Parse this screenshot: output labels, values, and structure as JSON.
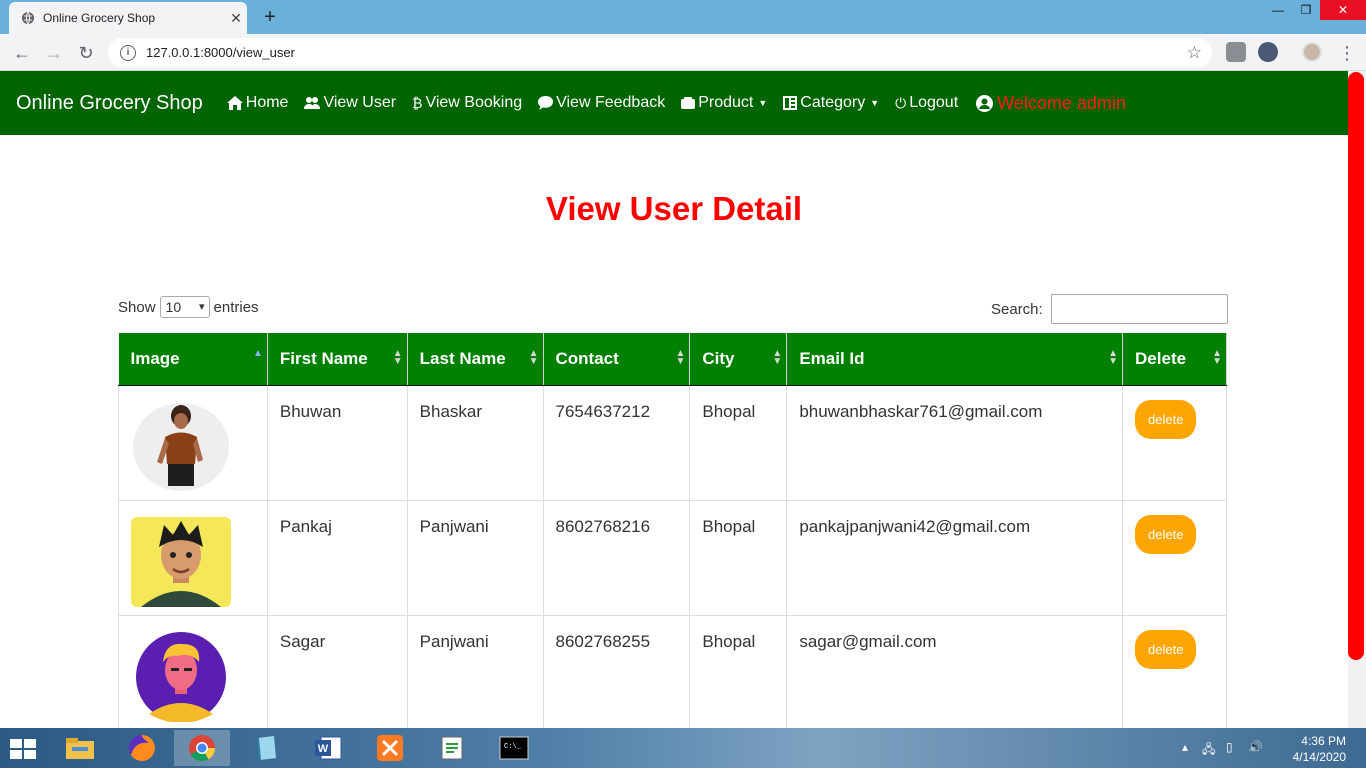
{
  "browser": {
    "tab_title": "Online Grocery Shop",
    "url": "127.0.0.1:8000/view_user"
  },
  "navbar": {
    "brand": "Online Grocery Shop",
    "items": [
      {
        "label": "Home",
        "icon": "home-icon"
      },
      {
        "label": "View User",
        "icon": "users-icon"
      },
      {
        "label": "View Booking",
        "icon": "bitcoin-icon"
      },
      {
        "label": "View Feedback",
        "icon": "comment-icon"
      },
      {
        "label": "Product",
        "icon": "product-icon"
      },
      {
        "label": "Category",
        "icon": "category-icon"
      },
      {
        "label": "Logout",
        "icon": "power-icon"
      }
    ],
    "welcome": "Welcome admin"
  },
  "main": {
    "title": "View User Detail",
    "length": {
      "show": "Show",
      "value": "10",
      "entries": "entries"
    },
    "search_label": "Search:",
    "search_value": "",
    "columns": [
      "Image",
      "First Name",
      "Last Name",
      "Contact",
      "City",
      "Email Id",
      "Delete"
    ],
    "rows": [
      {
        "first": "Bhuwan",
        "last": "Bhaskar",
        "contact": "7654637212",
        "city": "Bhopal",
        "email": "bhuwanbhaskar761@gmail.com",
        "action": "delete"
      },
      {
        "first": "Pankaj",
        "last": "Panjwani",
        "contact": "8602768216",
        "city": "Bhopal",
        "email": "pankajpanjwani42@gmail.com",
        "action": "delete"
      },
      {
        "first": "Sagar",
        "last": "Panjwani",
        "contact": "8602768255",
        "city": "Bhopal",
        "email": "sagar@gmail.com",
        "action": "delete"
      }
    ]
  },
  "taskbar": {
    "time": "4:36 PM",
    "date": "4/14/2020"
  },
  "colors": {
    "navbar": "#006400",
    "table_header": "#008000",
    "title": "#ff0000",
    "delete_button": "#ffa500"
  }
}
